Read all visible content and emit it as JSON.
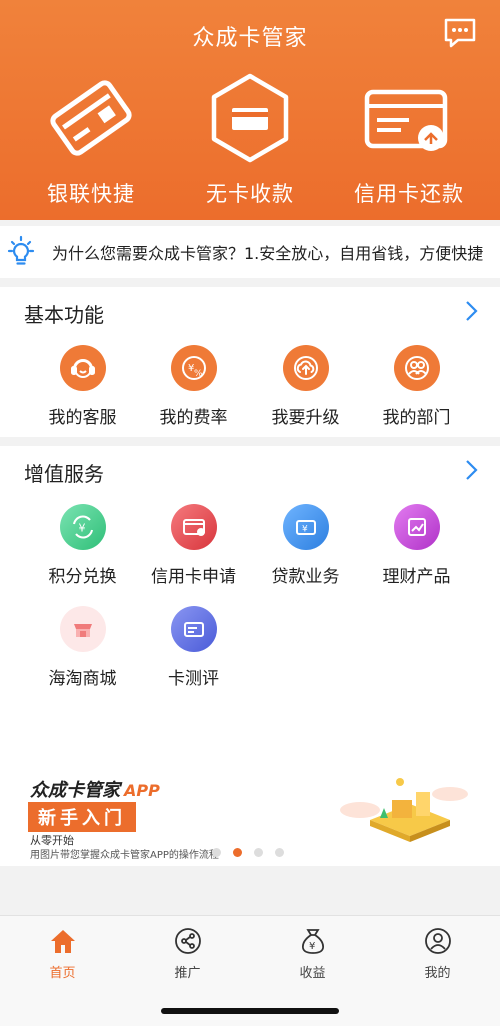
{
  "header": {
    "title": "众成卡管家",
    "message_icon": "chat-bubble-icon"
  },
  "hero": [
    {
      "label": "银联快捷",
      "icon": "card-icon"
    },
    {
      "label": "无卡收款",
      "icon": "hexagon-card-icon"
    },
    {
      "label": "信用卡还款",
      "icon": "credit-card-repay-icon"
    }
  ],
  "notice": {
    "icon": "lightbulb-icon",
    "text": "为什么您需要众成卡管家？1.安全放心，自用省钱，方便快捷"
  },
  "basic": {
    "title": "基本功能",
    "items": [
      {
        "label": "我的客服",
        "icon": "headset-icon",
        "color": "#ef7a37"
      },
      {
        "label": "我的费率",
        "icon": "yuan-percent-icon",
        "color": "#ef7a37"
      },
      {
        "label": "我要升级",
        "icon": "cloud-upload-icon",
        "color": "#ef7a37"
      },
      {
        "label": "我的部门",
        "icon": "group-icon",
        "color": "#ef7a37"
      }
    ]
  },
  "value": {
    "title": "增值服务",
    "items": [
      {
        "label": "积分兑换",
        "icon": "points-exchange-icon",
        "color": "#3fcf8e"
      },
      {
        "label": "信用卡申请",
        "icon": "card-apply-icon",
        "color": "#e8484e"
      },
      {
        "label": "贷款业务",
        "icon": "loan-icon",
        "color": "#3b8ff0"
      },
      {
        "label": "理财产品",
        "icon": "chart-icon",
        "color": "#c84ad8"
      },
      {
        "label": "海淘商城",
        "icon": "store-icon",
        "color": "#f07b7b"
      },
      {
        "label": "卡测评",
        "icon": "card-check-icon",
        "color": "#5b6ee0"
      }
    ]
  },
  "banner": {
    "title": "众成卡管家",
    "app_tag": "APP",
    "badge": "新手入门",
    "sub1": "从零开始",
    "sub2": "用图片带您掌握众成卡管家APP的操作流程",
    "active_dot": 1
  },
  "tabs": [
    {
      "label": "首页",
      "icon": "home-icon",
      "active": true
    },
    {
      "label": "推广",
      "icon": "share-icon",
      "active": false
    },
    {
      "label": "收益",
      "icon": "money-bag-icon",
      "active": false
    },
    {
      "label": "我的",
      "icon": "user-icon",
      "active": false
    }
  ],
  "colors": {
    "brand": "#ec6d2c"
  }
}
